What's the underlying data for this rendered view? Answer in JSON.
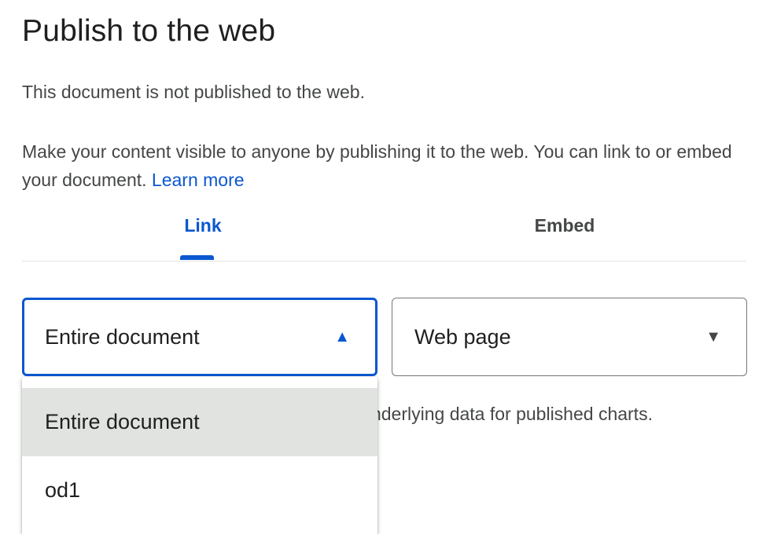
{
  "dialog": {
    "title": "Publish to the web",
    "status": "This document is not published to the web.",
    "description": "Make your content visible to anyone by publishing it to the web. You can link to or embed your document.",
    "learn_more": "Learn more"
  },
  "tabs": [
    {
      "label": "Link",
      "active": true
    },
    {
      "label": "Embed",
      "active": false
    }
  ],
  "selects": {
    "scope": {
      "value": "Entire document",
      "expanded": true
    },
    "format": {
      "value": "Web page",
      "expanded": false
    }
  },
  "partial_note": "e underlying data for published charts.",
  "dropdown_menu": {
    "items": [
      {
        "label": "Entire document",
        "selected": true
      },
      {
        "label": "od1",
        "selected": false
      }
    ]
  },
  "icons": {
    "scope_arrow": "caret-up-icon",
    "format_arrow": "caret-down-icon"
  },
  "colors": {
    "accent": "#0b57d0",
    "text": "#1f1f1f",
    "secondary_text": "#444746",
    "selected_item_bg": "#e1e3e1"
  }
}
